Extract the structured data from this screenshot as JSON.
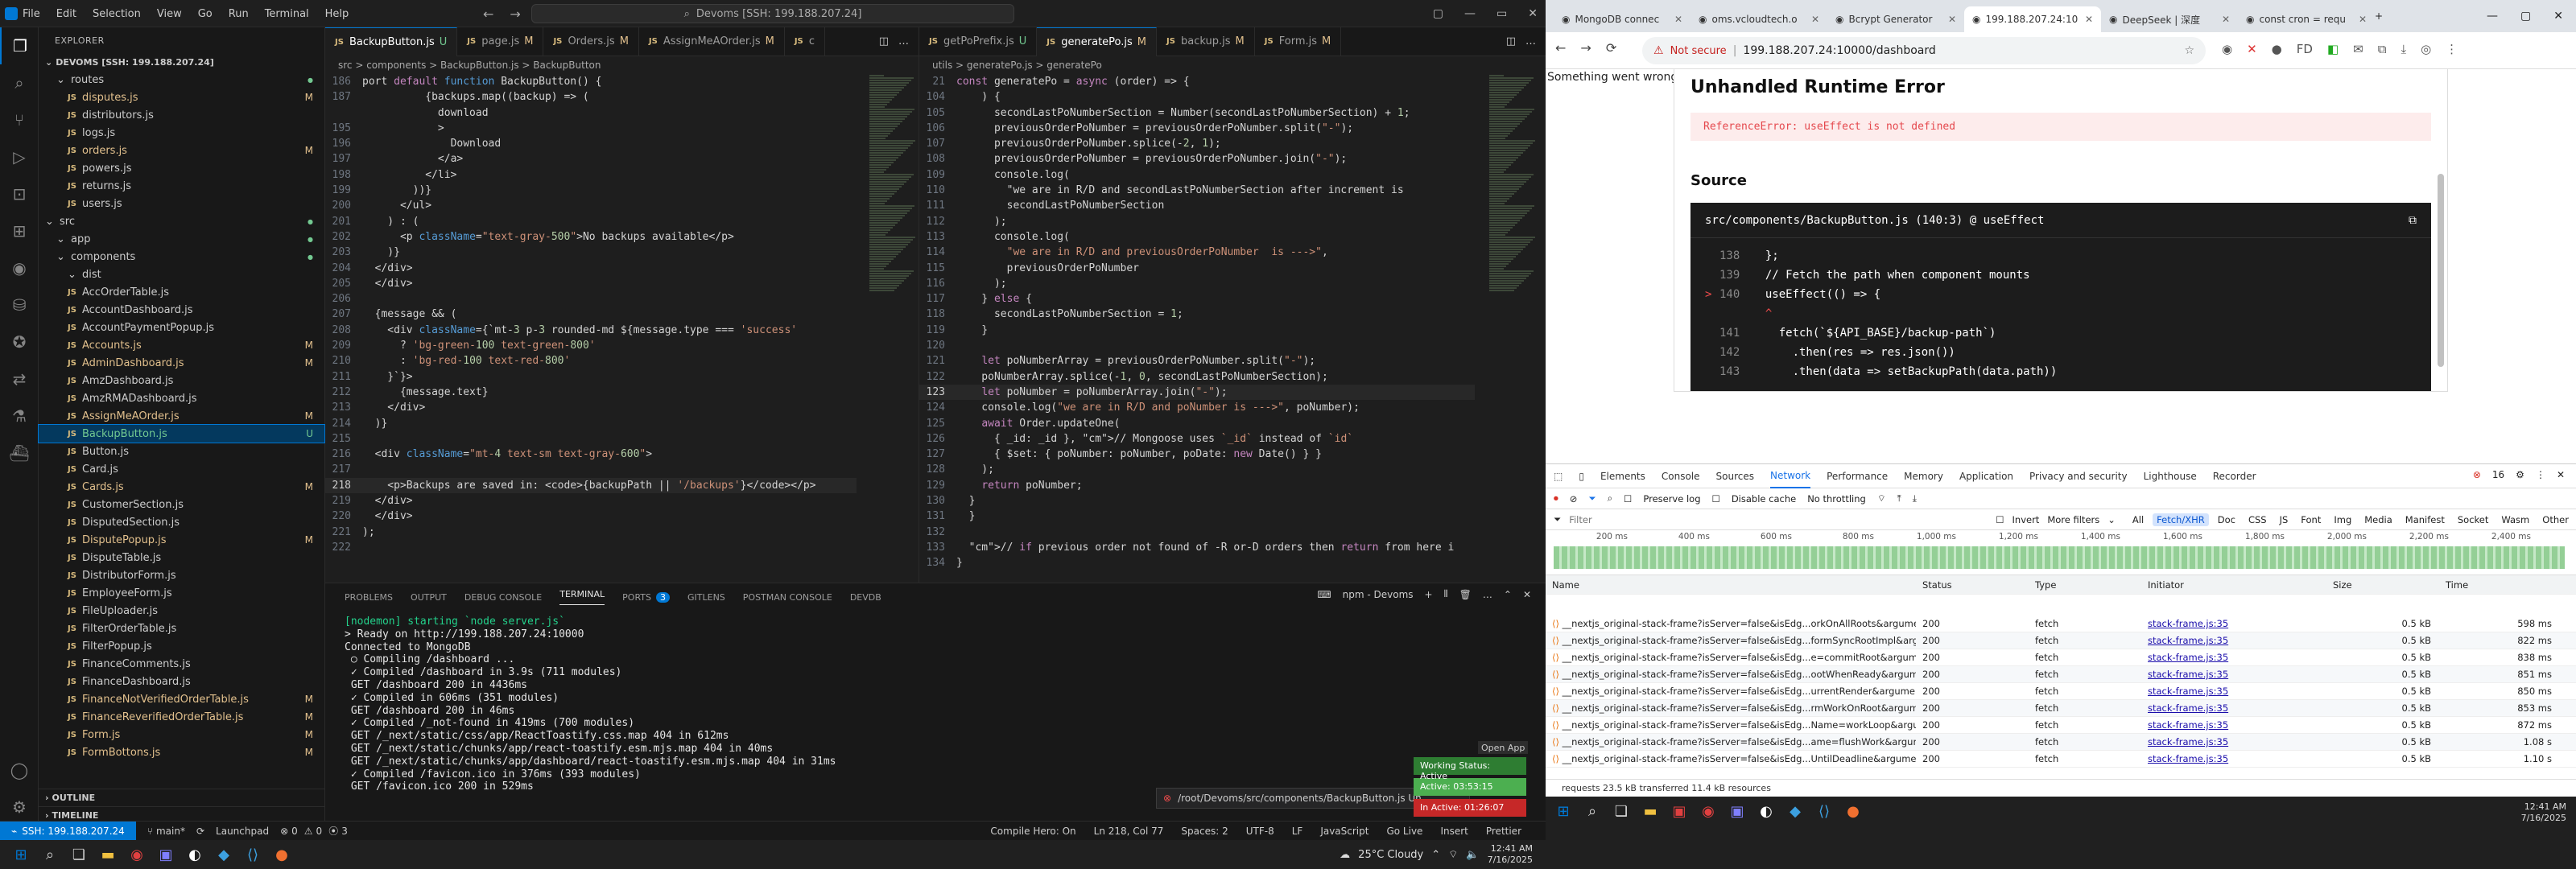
{
  "vscode": {
    "menu": [
      "File",
      "Edit",
      "Selection",
      "View",
      "Go",
      "Run",
      "Terminal",
      "Help"
    ],
    "command_center": "Devoms [SSH: 199.188.207.24]",
    "explorer_title": "EXPLORER",
    "workspace": "DEVOMS [SSH: 199.188.207.24]",
    "tree": [
      {
        "label": "routes",
        "type": "folder",
        "indent": 1,
        "status": "dot"
      },
      {
        "label": "disputes.js",
        "indent": 2,
        "status": "M"
      },
      {
        "label": "distributors.js",
        "indent": 2,
        "status": ""
      },
      {
        "label": "logs.js",
        "indent": 2,
        "status": ""
      },
      {
        "label": "orders.js",
        "indent": 2,
        "status": "M"
      },
      {
        "label": "powers.js",
        "indent": 2,
        "status": ""
      },
      {
        "label": "returns.js",
        "indent": 2,
        "status": ""
      },
      {
        "label": "users.js",
        "indent": 2,
        "status": ""
      },
      {
        "label": "src",
        "type": "folder",
        "indent": 0,
        "status": "dot"
      },
      {
        "label": "app",
        "type": "folder",
        "indent": 1,
        "status": "dot"
      },
      {
        "label": "components",
        "type": "folder",
        "indent": 1,
        "status": "dot"
      },
      {
        "label": "dist",
        "type": "folder",
        "indent": 2,
        "status": ""
      },
      {
        "label": "AccOrderTable.js",
        "indent": 2,
        "status": ""
      },
      {
        "label": "AccountDashboard.js",
        "indent": 2,
        "status": ""
      },
      {
        "label": "AccountPaymentPopup.js",
        "indent": 2,
        "status": ""
      },
      {
        "label": "Accounts.js",
        "indent": 2,
        "status": "M"
      },
      {
        "label": "AdminDashboard.js",
        "indent": 2,
        "status": "M"
      },
      {
        "label": "AmzDashboard.js",
        "indent": 2,
        "status": ""
      },
      {
        "label": "AmzRMADashboard.js",
        "indent": 2,
        "status": ""
      },
      {
        "label": "AssignMeAOrder.js",
        "indent": 2,
        "status": "M"
      },
      {
        "label": "BackupButton.js",
        "indent": 2,
        "status": "U",
        "selected": true
      },
      {
        "label": "Button.js",
        "indent": 2,
        "status": ""
      },
      {
        "label": "Card.js",
        "indent": 2,
        "status": ""
      },
      {
        "label": "Cards.js",
        "indent": 2,
        "status": "M"
      },
      {
        "label": "CustomerSection.js",
        "indent": 2,
        "status": ""
      },
      {
        "label": "DisputedSection.js",
        "indent": 2,
        "status": ""
      },
      {
        "label": "DisputePopup.js",
        "indent": 2,
        "status": "M"
      },
      {
        "label": "DisputeTable.js",
        "indent": 2,
        "status": ""
      },
      {
        "label": "DistributorForm.js",
        "indent": 2,
        "status": ""
      },
      {
        "label": "EmployeeForm.js",
        "indent": 2,
        "status": ""
      },
      {
        "label": "FileUploader.js",
        "indent": 2,
        "status": ""
      },
      {
        "label": "FilterOrderTable.js",
        "indent": 2,
        "status": ""
      },
      {
        "label": "FilterPopup.js",
        "indent": 2,
        "status": ""
      },
      {
        "label": "FinanceComments.js",
        "indent": 2,
        "status": ""
      },
      {
        "label": "FinanceDashboard.js",
        "indent": 2,
        "status": ""
      },
      {
        "label": "FinanceNotVerifiedOrderTable.js",
        "indent": 2,
        "status": "M"
      },
      {
        "label": "FinanceReverifiedOrderTable.js",
        "indent": 2,
        "status": "M"
      },
      {
        "label": "Form.js",
        "indent": 2,
        "status": "M"
      },
      {
        "label": "FormBottons.js",
        "indent": 2,
        "status": "M"
      }
    ],
    "outline": "OUTLINE",
    "timeline": "TIMELINE",
    "tabs_left": [
      {
        "label": "BackupButton.js",
        "badge": "U",
        "active": true
      },
      {
        "label": "page.js",
        "badge": "M"
      },
      {
        "label": "Orders.js",
        "badge": "M"
      },
      {
        "label": "AssignMeAOrder.js",
        "badge": "M"
      },
      {
        "label": "c",
        "badge": ""
      }
    ],
    "tabs_right": [
      {
        "label": "getPoPrefix.js",
        "badge": "U"
      },
      {
        "label": "generatePo.js",
        "badge": "M",
        "active": true
      },
      {
        "label": "backup.js",
        "badge": "M"
      },
      {
        "label": "Form.js",
        "badge": "M"
      }
    ],
    "crumb_left": "src > components > BackupButton.js > BackupButton",
    "crumb_right": "utils > generatePo.js > generatePo",
    "left_code": [
      {
        "n": "186",
        "t": "port default function BackupButton() {"
      },
      {
        "n": "187",
        "t": "          {backups.map((backup) => ("
      },
      {
        "n": "",
        "t": "            download"
      },
      {
        "n": "195",
        "t": "            >"
      },
      {
        "n": "196",
        "t": "              Download"
      },
      {
        "n": "197",
        "t": "            </a>"
      },
      {
        "n": "198",
        "t": "          </li>"
      },
      {
        "n": "199",
        "t": "        ))}"
      },
      {
        "n": "200",
        "t": "      </ul>"
      },
      {
        "n": "201",
        "t": "    ) : ("
      },
      {
        "n": "202",
        "t": "      <p className=\"text-gray-500\">No backups available</p>"
      },
      {
        "n": "203",
        "t": "    )}"
      },
      {
        "n": "204",
        "t": "  </div>"
      },
      {
        "n": "205",
        "t": "  </div>"
      },
      {
        "n": "206",
        "t": ""
      },
      {
        "n": "207",
        "t": "  {message && ("
      },
      {
        "n": "208",
        "t": "    <div className={`mt-3 p-3 rounded-md ${message.type === 'success'"
      },
      {
        "n": "209",
        "t": "      ? 'bg-green-100 text-green-800'"
      },
      {
        "n": "210",
        "t": "      : 'bg-red-100 text-red-800'"
      },
      {
        "n": "211",
        "t": "    }`}>"
      },
      {
        "n": "212",
        "t": "      {message.text}"
      },
      {
        "n": "213",
        "t": "    </div>"
      },
      {
        "n": "214",
        "t": "  )}"
      },
      {
        "n": "215",
        "t": ""
      },
      {
        "n": "216",
        "t": "  <div className=\"mt-4 text-sm text-gray-600\">"
      },
      {
        "n": "217",
        "t": ""
      },
      {
        "n": "218",
        "t": "    <p>Backups are saved in: <code>{backupPath || '/backups'}</code></p>"
      },
      {
        "n": "219",
        "t": "  </div>"
      },
      {
        "n": "220",
        "t": "  </div>"
      },
      {
        "n": "221",
        "t": ");"
      },
      {
        "n": "222",
        "t": ""
      }
    ],
    "right_code": [
      {
        "n": "21",
        "t": "const generatePo = async (order) => {"
      },
      {
        "n": "104",
        "t": "    ) {"
      },
      {
        "n": "105",
        "t": "      secondLastPoNumberSection = Number(secondLastPoNumberSection) + 1;"
      },
      {
        "n": "106",
        "t": "      previousOrderPoNumber = previousOrderPoNumber.split(\"-\");"
      },
      {
        "n": "107",
        "t": "      previousOrderPoNumber.splice(-2, 1);"
      },
      {
        "n": "108",
        "t": "      previousOrderPoNumber = previousOrderPoNumber.join(\"-\");"
      },
      {
        "n": "109",
        "t": "      console.log("
      },
      {
        "n": "110",
        "t": "        \"we are in R/D and secondLastPoNumberSection after increment is"
      },
      {
        "n": "111",
        "t": "        secondLastPoNumberSection"
      },
      {
        "n": "112",
        "t": "      );"
      },
      {
        "n": "113",
        "t": "      console.log("
      },
      {
        "n": "114",
        "t": "        \"we are in R/D and previousOrderPoNumber  is --->\","
      },
      {
        "n": "115",
        "t": "        previousOrderPoNumber"
      },
      {
        "n": "116",
        "t": "      );"
      },
      {
        "n": "117",
        "t": "    } else {"
      },
      {
        "n": "118",
        "t": "      secondLastPoNumberSection = 1;"
      },
      {
        "n": "119",
        "t": "    }"
      },
      {
        "n": "120",
        "t": ""
      },
      {
        "n": "121",
        "t": "    let poNumberArray = previousOrderPoNumber.split(\"-\");"
      },
      {
        "n": "122",
        "t": "    poNumberArray.splice(-1, 0, secondLastPoNumberSection);"
      },
      {
        "n": "123",
        "t": "    let poNumber = poNumberArray.join(\"-\");"
      },
      {
        "n": "124",
        "t": "    console.log(\"we are in R/D and poNumber is --->\", poNumber);"
      },
      {
        "n": "125",
        "t": "    await Order.updateOne("
      },
      {
        "n": "126",
        "t": "      { _id: _id }, // Mongoose uses `_id` instead of `id`"
      },
      {
        "n": "127",
        "t": "      { $set: { poNumber: poNumber, poDate: new Date() } }"
      },
      {
        "n": "128",
        "t": "    );"
      },
      {
        "n": "129",
        "t": "    return poNumber;"
      },
      {
        "n": "130",
        "t": "  }"
      },
      {
        "n": "131",
        "t": "  }"
      },
      {
        "n": "132",
        "t": ""
      },
      {
        "n": "133",
        "t": "  // if previous order not found of -R or-D orders then return from here i"
      },
      {
        "n": "134",
        "t": "}"
      }
    ],
    "panel_tabs": [
      "PROBLEMS",
      "OUTPUT",
      "DEBUG CONSOLE",
      "TERMINAL",
      "PORTS",
      "GITLENS",
      "POSTMAN CONSOLE",
      "DEVDB"
    ],
    "ports_count": "3",
    "terminal_name": "npm - Devoms",
    "terminal": [
      {
        "c": "g",
        "t": "[nodemon] starting `node server.js`"
      },
      {
        "c": "w",
        "t": "> Ready on http://199.188.207.24:10000"
      },
      {
        "c": "w",
        "t": "Connected to MongoDB"
      },
      {
        "c": "w",
        "t": " ○ Compiling /dashboard ..."
      },
      {
        "c": "w",
        "t": " ✓ Compiled /dashboard in 3.9s (711 modules)"
      },
      {
        "c": "w",
        "t": " GET /dashboard 200 in 4436ms"
      },
      {
        "c": "w",
        "t": " ✓ Compiled in 606ms (351 modules)"
      },
      {
        "c": "w",
        "t": " GET /dashboard 200 in 46ms"
      },
      {
        "c": "w",
        "t": " ✓ Compiled /_not-found in 419ms (700 modules)"
      },
      {
        "c": "w",
        "t": " GET /_next/static/css/app/ReactToastify.css.map 404 in 612ms"
      },
      {
        "c": "w",
        "t": " GET /_next/static/chunks/app/react-toastify.esm.mjs.map 404 in 40ms"
      },
      {
        "c": "w",
        "t": " GET /_next/static/chunks/app/dashboard/react-toastify.esm.mjs.map 404 in 31ms"
      },
      {
        "c": "w",
        "t": " ✓ Compiled /favicon.ico in 376ms (393 modules)"
      },
      {
        "c": "w",
        "t": " GET /favicon.ico 200 in 529ms"
      }
    ],
    "notif_path": "/root/Devoms/src/components/BackupButton.js Un",
    "open_app": "Open App",
    "working_status": "Working Status: Active",
    "active_time": "Active: 03:53:15",
    "inactive_time": "In Active: 01:26:07",
    "status": {
      "remote": "SSH: 199.188.207.24",
      "branch": "main*",
      "launchpad": "Launchpad",
      "errors": "0",
      "warnings": "0",
      "ports": "3",
      "compile": "Compile Hero: On",
      "position": "Ln 218, Col 77",
      "spaces": "Spaces: 2",
      "encoding": "UTF-8",
      "eol": "LF",
      "lang": "JavaScript",
      "golive": "Go Live",
      "insert": "Insert",
      "prettier": "Prettier"
    },
    "weather": "25°C Cloudy",
    "time": "12:41 AM",
    "date": "7/16/2025"
  },
  "chrome": {
    "tabs": [
      "MongoDB connec",
      "oms.vcloudtech.o",
      "Bcrypt Generator",
      "199.188.207.24:10",
      "DeepSeek | 深度",
      "const cron = requ"
    ],
    "active_tab": 3,
    "url": "199.188.207.24:10000/dashboard",
    "not_secure": "Not secure",
    "page_text": "Something went wrong",
    "error_title": "Unhandled Runtime Error",
    "error_msg": "ReferenceError: useEffect is not defined",
    "source_label": "Source",
    "source_file": "src/components/BackupButton.js (140:3) @ useEffect",
    "source_lines": [
      {
        "n": "138",
        "t": "  };"
      },
      {
        "n": "139",
        "t": "  // Fetch the path when component mounts"
      },
      {
        "n": "140",
        "t": "  useEffect(() => {",
        "mark": ">"
      },
      {
        "n": "",
        "t": "  ^"
      },
      {
        "n": "141",
        "t": "    fetch(`${API_BASE}/backup-path`)"
      },
      {
        "n": "142",
        "t": "      .then(res => res.json())"
      },
      {
        "n": "143",
        "t": "      .then(data => setBackupPath(data.path))"
      }
    ],
    "devtools_tabs": [
      "Elements",
      "Console",
      "Sources",
      "Network",
      "Performance",
      "Memory",
      "Application",
      "Privacy and security",
      "Lighthouse",
      "Recorder"
    ],
    "issues": "16",
    "preserve_log": "Preserve log",
    "disable_cache": "Disable cache",
    "throttle": "No throttling",
    "filter_placeholder": "Filter",
    "invert": "Invert",
    "more_filters": "More filters",
    "filter_types": [
      "All",
      "Fetch/XHR",
      "Doc",
      "CSS",
      "JS",
      "Font",
      "Img",
      "Media",
      "Manifest",
      "Socket",
      "Wasm",
      "Other"
    ],
    "timeline_ticks": [
      "200 ms",
      "400 ms",
      "600 ms",
      "800 ms",
      "1,000 ms",
      "1,200 ms",
      "1,400 ms",
      "1,600 ms",
      "1,800 ms",
      "2,000 ms",
      "2,200 ms",
      "2,400 ms"
    ],
    "net_headers": [
      "Name",
      "Status",
      "Type",
      "Initiator",
      "Size",
      "Time"
    ],
    "net_rows": [
      {
        "name": "__nextjs_original-stack-frame?isServer=false&isEdg...orkOnAllRoots&argument...",
        "status": "200",
        "type": "fetch",
        "init": "stack-frame.js:35",
        "size": "0.5 kB",
        "time": "598 ms"
      },
      {
        "name": "__nextjs_original-stack-frame?isServer=false&isEdg...formSyncRootImpl&argumen...",
        "status": "200",
        "type": "fetch",
        "init": "stack-frame.js:35",
        "size": "0.5 kB",
        "time": "822 ms"
      },
      {
        "name": "__nextjs_original-stack-frame?isServer=false&isEdg...e=commitRoot&arguments...",
        "status": "200",
        "type": "fetch",
        "init": "stack-frame.js:35",
        "size": "0.5 kB",
        "time": "838 ms"
      },
      {
        "name": "__nextjs_original-stack-frame?isServer=false&isEdg...ootWhenReady&argumen...",
        "status": "200",
        "type": "fetch",
        "init": "stack-frame.js:35",
        "size": "0.5 kB",
        "time": "851 ms"
      },
      {
        "name": "__nextjs_original-stack-frame?isServer=false&isEdg...urrentRender&argument...",
        "status": "200",
        "type": "fetch",
        "init": "stack-frame.js:35",
        "size": "0.5 kB",
        "time": "850 ms"
      },
      {
        "name": "__nextjs_original-stack-frame?isServer=false&isEdg...rmWorkOnRoot&argumen...",
        "status": "200",
        "type": "fetch",
        "init": "stack-frame.js:35",
        "size": "0.5 kB",
        "time": "853 ms"
      },
      {
        "name": "__nextjs_original-stack-frame?isServer=false&isEdg...Name=workLoop&argumen...",
        "status": "200",
        "type": "fetch",
        "init": "stack-frame.js:35",
        "size": "0.5 kB",
        "time": "872 ms"
      },
      {
        "name": "__nextjs_original-stack-frame?isServer=false&isEdg...ame=flushWork&argument...",
        "status": "200",
        "type": "fetch",
        "init": "stack-frame.js:35",
        "size": "0.5 kB",
        "time": "1.08 s"
      },
      {
        "name": "__nextjs_original-stack-frame?isServer=false&isEdg...UntilDeadline&argumen...",
        "status": "200",
        "type": "fetch",
        "init": "stack-frame.js:35",
        "size": "0.5 kB",
        "time": "1.10 s"
      }
    ],
    "summary": "requests    23.5 kB transferred    11.4 kB resources",
    "time": "12:41 AM",
    "date": "7/16/2025"
  }
}
